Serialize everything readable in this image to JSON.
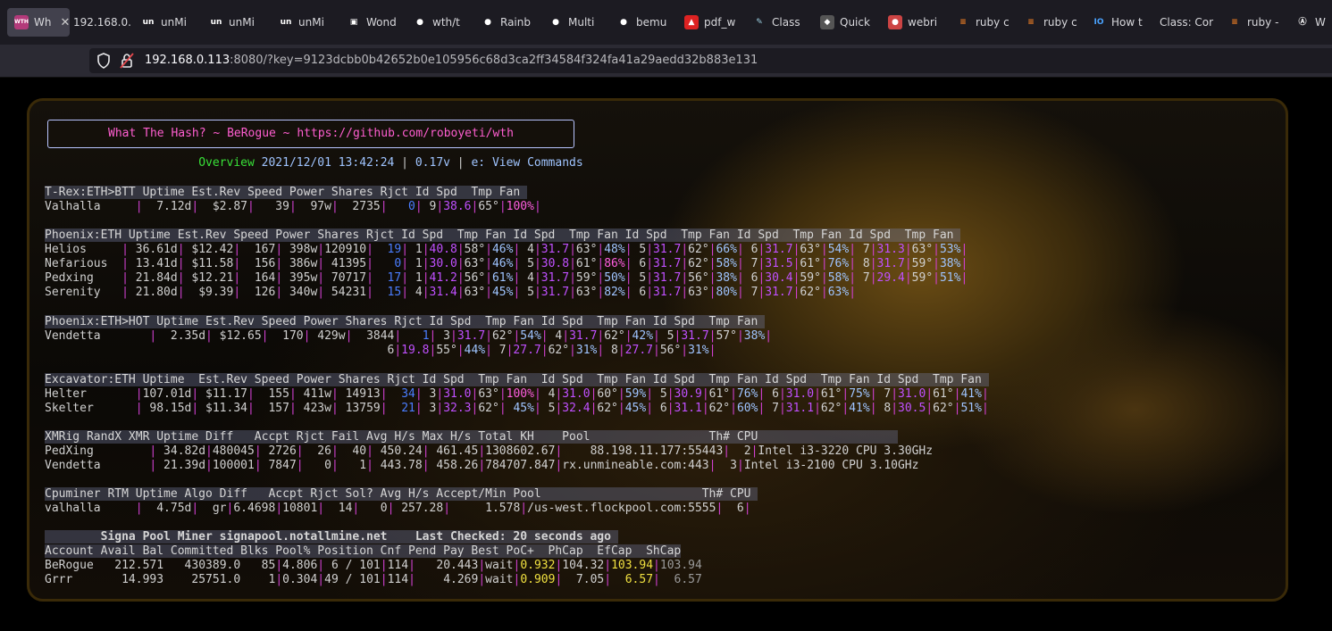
{
  "browser": {
    "tabs": [
      {
        "label": "Wh",
        "icon": "wth-icon",
        "active": true
      },
      {
        "label": "192.168.0.",
        "icon": "none"
      },
      {
        "label": "unMi",
        "icon": "unmineable-icon"
      },
      {
        "label": "unMi",
        "icon": "unmineable-icon"
      },
      {
        "label": "unMi",
        "icon": "unmineable-icon"
      },
      {
        "label": "Wond",
        "icon": "page-icon"
      },
      {
        "label": "wth/t",
        "icon": "github-icon"
      },
      {
        "label": "Rainb",
        "icon": "github-icon"
      },
      {
        "label": "Multi",
        "icon": "github-icon"
      },
      {
        "label": "bemu",
        "icon": "github-icon"
      },
      {
        "label": "pdf_w",
        "icon": "red-icon"
      },
      {
        "label": "Class",
        "icon": "pencil-icon"
      },
      {
        "label": "Quick",
        "icon": "quick-icon"
      },
      {
        "label": "webri",
        "icon": "webrick-icon"
      },
      {
        "label": "ruby c",
        "icon": "stack-icon"
      },
      {
        "label": "ruby c",
        "icon": "stack-icon"
      },
      {
        "label": "How t",
        "icon": "io-icon"
      },
      {
        "label": "Class: Cor",
        "icon": "none"
      },
      {
        "label": "ruby -",
        "icon": "stack-icon"
      },
      {
        "label": "W",
        "icon": "a-icon"
      }
    ],
    "url_host": "192.168.0.113",
    "url_rest": ":8080/?key=9123dcbb0b42652b0e105956c68d3ca2ff34584f324fa41a29aedd32b883e131"
  },
  "terminal": {
    "banner": "What The Hash? ~ BeRogue ~ https://github.com/roboyeti/wth",
    "overview": {
      "label": "Overview",
      "datetime": "2021/12/01 13:42:24",
      "version": "0.17v",
      "commands": "e: View Commands"
    },
    "trex": {
      "header": "T-Rex:ETH>BTT Uptime Est.Rev Speed Power Shares Rjct Id Spd  Tmp Fan ",
      "rows": [
        {
          "name": "Valhalla     ",
          "uptime": "  7.12d",
          "rev": "  $2.87",
          "speed": "   39",
          "power": "  97w",
          "shares": "  2735",
          "rjct": "   0",
          "gpus": [
            [
              "9",
              "38.6",
              "65°",
              "100%"
            ]
          ]
        }
      ]
    },
    "phoenix": {
      "header": "Phoenix:ETH Uptime Est.Rev Speed Power Shares Rjct Id Spd  Tmp Fan Id Spd  Tmp Fan Id Spd  Tmp Fan Id Spd  Tmp Fan Id Spd  Tmp Fan ",
      "rows": [
        {
          "name": "Helios     ",
          "uptime": " 36.61d",
          "rev": " $12.42",
          "speed": "  167",
          "power": " 398w",
          "shares": "120910",
          "rjct": "  19",
          "gpus": [
            [
              "1",
              "40.8",
              "58°",
              "46%"
            ],
            [
              "4",
              "31.7",
              "63°",
              "48%"
            ],
            [
              "5",
              "31.7",
              "62°",
              "66%"
            ],
            [
              "6",
              "31.7",
              "63°",
              "54%"
            ],
            [
              "7",
              "31.3",
              "63°",
              "53%"
            ]
          ]
        },
        {
          "name": "Nefarious  ",
          "uptime": " 13.41d",
          "rev": " $11.58",
          "speed": "  156",
          "power": " 386w",
          "shares": " 41395",
          "rjct": "   0",
          "gpus": [
            [
              "1",
              "30.0",
              "63°",
              "46%"
            ],
            [
              "5",
              "30.8",
              "61°",
              "86%"
            ],
            [
              "6",
              "31.7",
              "62°",
              "58%"
            ],
            [
              "7",
              "31.5",
              "61°",
              "76%"
            ],
            [
              "8",
              "31.7",
              "59°",
              "38%"
            ]
          ]
        },
        {
          "name": "Pedxing    ",
          "uptime": " 21.84d",
          "rev": " $12.21",
          "speed": "  164",
          "power": " 395w",
          "shares": " 70717",
          "rjct": "  17",
          "gpus": [
            [
              "1",
              "41.2",
              "56°",
              "61%"
            ],
            [
              "4",
              "31.7",
              "59°",
              "50%"
            ],
            [
              "5",
              "31.7",
              "56°",
              "38%"
            ],
            [
              "6",
              "30.4",
              "59°",
              "58%"
            ],
            [
              "7",
              "29.4",
              "59°",
              "51%"
            ]
          ]
        },
        {
          "name": "Serenity   ",
          "uptime": " 21.80d",
          "rev": "  $9.39",
          "speed": "  126",
          "power": " 340w",
          "shares": " 54231",
          "rjct": "  15",
          "gpus": [
            [
              "4",
              "31.4",
              "63°",
              "45%"
            ],
            [
              "5",
              "31.7",
              "63°",
              "82%"
            ],
            [
              "6",
              "31.7",
              "63°",
              "80%"
            ],
            [
              "7",
              "31.7",
              "62°",
              "63%"
            ]
          ]
        }
      ]
    },
    "phoenix_hot": {
      "header": "Phoenix:ETH>HOT Uptime Est.Rev Speed Power Shares Rjct Id Spd  Tmp Fan Id Spd  Tmp Fan Id Spd  Tmp Fan ",
      "rows": [
        {
          "name": "Vendetta       ",
          "uptime": "  2.35d",
          "rev": " $12.65",
          "speed": "  170",
          "power": " 429w",
          "shares": "  3844",
          "rjct": "   1",
          "gpus": [
            [
              "3",
              "31.7",
              "62°",
              "54%"
            ],
            [
              "4",
              "31.7",
              "62°",
              "42%"
            ],
            [
              "5",
              "31.7",
              "57°",
              "38%"
            ]
          ]
        },
        {
          "name": "",
          "gpus": [
            [
              "6",
              "19.8",
              "55°",
              "44%"
            ],
            [
              "7",
              "27.7",
              "62°",
              "31%"
            ],
            [
              "8",
              "27.7",
              "56°",
              "31%"
            ]
          ]
        }
      ]
    },
    "excavator": {
      "header": "Excavator:ETH Uptime  Est.Rev Speed Power Shares Rjct Id Spd  Tmp Fan  Id Spd  Tmp Fan Id Spd  Tmp Fan Id Spd  Tmp Fan Id Spd  Tmp Fan ",
      "rows": [
        {
          "name": "Helter       ",
          "uptime": "107.01d",
          "rev": " $11.17",
          "speed": "  155",
          "power": " 411w",
          "shares": " 14913",
          "rjct": "  34",
          "gpus": [
            [
              "3",
              "31.0",
              "63°",
              "100%"
            ],
            [
              "4",
              "31.0",
              "60°",
              "59%"
            ],
            [
              "5",
              "30.9",
              "61°",
              "76%"
            ],
            [
              "6",
              "31.0",
              "61°",
              "75%"
            ],
            [
              "7",
              "31.0",
              "61°",
              "41%"
            ]
          ]
        },
        {
          "name": "Skelter      ",
          "uptime": " 98.15d",
          "rev": " $11.34",
          "speed": "  157",
          "power": " 423w",
          "shares": " 13759",
          "rjct": "  21",
          "gpus": [
            [
              "3",
              "32.3",
              "62°",
              " 45%"
            ],
            [
              "5",
              "32.4",
              "62°",
              "45%"
            ],
            [
              "6",
              "31.1",
              "62°",
              "60%"
            ],
            [
              "7",
              "31.1",
              "62°",
              "41%"
            ],
            [
              "8",
              "30.5",
              "62°",
              "51%"
            ]
          ]
        }
      ]
    },
    "xmrig": {
      "header": "XMRig RandX XMR Uptime Diff   Accpt Rjct Fail Avg H/s Max H/s Total KH    Pool                 Th# CPU                    ",
      "rows": [
        {
          "name": "PedXing        ",
          "uptime": " 34.82d",
          "diff": "480045",
          "accpt": " 2726",
          "rjct": "  26",
          "fail": "  40",
          "avg": " 450.24",
          "max": " 461.45",
          "total": "1308602.67",
          "pool": "    88.198.11.177:55443",
          "th": "  2",
          "cpu": "Intel i3-3220 CPU 3.30GHz"
        },
        {
          "name": "Vendetta       ",
          "uptime": " 21.39d",
          "diff": "100001",
          "accpt": " 7847",
          "rjct": "   0",
          "fail": "   1",
          "avg": " 443.78",
          "max": " 458.26",
          "total": "784707.847",
          "pool": "rx.unmineable.com:443",
          "th": "  3",
          "cpu": "Intel i3-2100 CPU 3.10GHz"
        }
      ]
    },
    "cpuminer": {
      "header": "Cpuminer RTM Uptime Algo Diff   Accpt Rjct Sol? Avg H/s Accept/Min Pool                       Th# CPU ",
      "rows": [
        {
          "name": "valhalla     ",
          "uptime": "  4.75d",
          "algo": "  gr",
          "diff": "6.4698",
          "accpt": "10801",
          "rjct": "  14",
          "sol": "   0",
          "avg": " 257.28",
          "apm": "     1.578",
          "pool": "/us-west.flockpool.com:5555",
          "th": "  6",
          "cpu": " "
        }
      ]
    },
    "signa": {
      "title": "        Signa Pool Miner signapool.notallmine.net    Last Checked: 20 seconds ago ",
      "header": "Account Avail Bal Committed Blks Pool% Position Cnf Pend Pay Best PoC+  PhCap  EfCap  ShCap",
      "rows": [
        {
          "account": "BeRogue",
          "avail": "  212.571",
          "committed": "  430389.0",
          "blks": "  85",
          "pool": "4.806",
          "position": " 6 / 101",
          "cnf": "114",
          "pend": "   20.443",
          "best": "wait",
          "poc": "0.932",
          "phcap": "104.32",
          "efcap": "103.94",
          "shcap": "103.94"
        },
        {
          "account": "Grrr   ",
          "avail": "   14.993",
          "committed": "   25751.0",
          "blks": "   1",
          "pool": "0.304",
          "position": "49 / 101",
          "cnf": "114",
          "pend": "    4.269",
          "best": "wait",
          "poc": "0.909",
          "phcap": "  7.05",
          "efcap": "  6.57",
          "shcap": "  6.57"
        }
      ]
    }
  }
}
